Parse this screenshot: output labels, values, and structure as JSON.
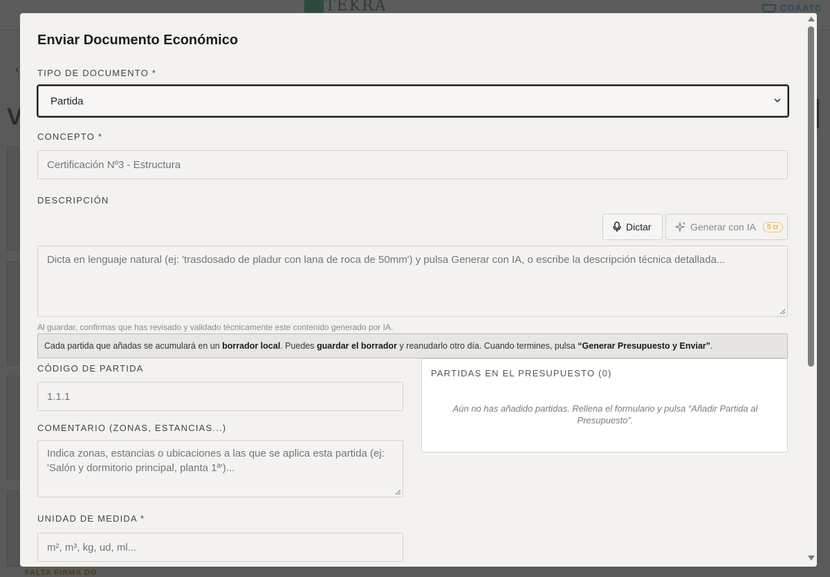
{
  "background": {
    "logo_text": "TEKRA",
    "org_text": "COAATC",
    "left_letter": "V",
    "bottom_text": "FALTA FIRMA DO"
  },
  "modal": {
    "title": "Enviar Documento Económico",
    "tipo_documento": {
      "label": "TIPO DE DOCUMENTO *",
      "value": "Partida"
    },
    "concepto": {
      "label": "CONCEPTO *",
      "value": "Certificación Nº3 - Estructura"
    },
    "descripcion": {
      "label": "DESCRIPCIÓN",
      "placeholder": "Dicta en lenguaje natural (ej: 'trasdosado de pladur con lana de roca de 50mm') y pulsa Generar con IA, o escribe la descripción técnica detallada..."
    },
    "buttons": {
      "dictar": "Dictar",
      "generar_ia": "Generar con IA",
      "credits": "5 cr"
    },
    "ai_note": "Al guardar, confirmas que has revisado y validado técnicamente este contenido generado por IA.",
    "info_bar": {
      "part1": "Cada partida que añadas se acumulará en un ",
      "bold1": "borrador local",
      "part2": ". Puedes ",
      "bold2": "guardar el borrador",
      "part3": " y reanudarlo otro día. Cuando termines, pulsa ",
      "bold3": "“Generar Presupuesto y Enviar”",
      "part4": "."
    },
    "codigo_partida": {
      "label": "CÓDIGO DE PARTIDA",
      "placeholder": "1.1.1"
    },
    "comentario": {
      "label": "COMENTARIO (ZONAS, ESTANCIAS...)",
      "placeholder": "Indica zonas, estancias o ubicaciones a las que se aplica esta partida (ej: 'Salón y dormitorio principal, planta 1ª')..."
    },
    "unidad_medida": {
      "label": "UNIDAD DE MEDIDA *",
      "placeholder": "m², m³, kg, ud, ml..."
    },
    "partidas_panel": {
      "title": "PARTIDAS EN EL PRESUPUESTO (0)",
      "empty_text": "Aún no has añadido partidas. Rellena el formulario y pulsa “Añadir Partida al Presupuesto”."
    }
  }
}
